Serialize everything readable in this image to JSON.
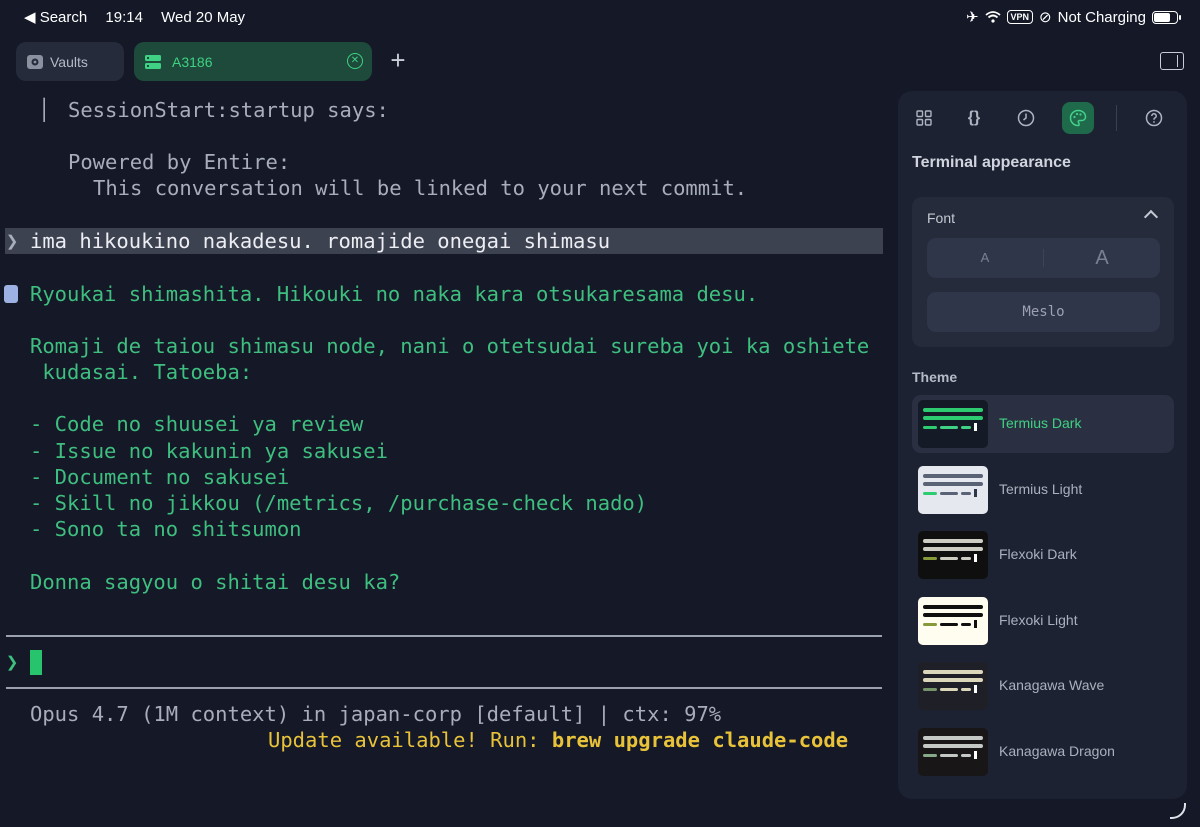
{
  "status_bar": {
    "back_label": "◀ Search",
    "time": "19:14",
    "date": "Wed 20 May",
    "vpn": "VPN",
    "charging": "Not Charging",
    "battery_level": 0.75
  },
  "tabs": [
    {
      "label": "Vaults",
      "icon": "vault-icon"
    },
    {
      "label": "A3186",
      "icon": "server-icon",
      "active": true
    }
  ],
  "terminal": {
    "hook_title": "SessionStart:startup says:",
    "hook_line1": "Powered by Entire:",
    "hook_line2": "This conversation will be linked to your next commit.",
    "user_prompt_glyph": "❯",
    "user_prompt": "ima hikoukino nakadesu. romajide onegai shimasu",
    "reply": [
      "Ryoukai shimashita. Hikouki no naka kara otsukaresama desu.",
      "Romaji de taiou shimasu node, nani o otetsudai sureba yoi ka oshiete",
      " kudasai. Tatoeba:",
      "- Code no shuusei ya review",
      "- Issue no kakunin ya sakusei",
      "- Document no sakusei",
      "- Skill no jikkou (/metrics, /purchase-check nado)",
      "- Sono ta no shitsumon",
      "Donna sagyou o shitai desu ka?"
    ],
    "input_prompt": "❯",
    "status_line": "Opus 4.7 (1M context) in japan-corp [default] | ctx: 97%",
    "update_prefix": "Update available! Run: ",
    "update_command": "brew upgrade claude-code"
  },
  "panel": {
    "title": "Terminal appearance",
    "font_section": "Font",
    "size_small": "A",
    "size_large": "A",
    "font_family": "Meslo",
    "theme_section": "Theme",
    "themes": [
      {
        "name": "Termius Dark",
        "selected": true,
        "bg": "#141a26",
        "bar1": "#2ecc71",
        "bar2": "#2ecc71",
        "d1": "#2ecc71",
        "d2": "#3fd184",
        "d3": "#3fd184",
        "d4": "#ffffff"
      },
      {
        "name": "Termius Light",
        "selected": false,
        "bg": "#e5e8ef",
        "bar1": "#5a6275",
        "bar2": "#5a6275",
        "d1": "#2ecc71",
        "d2": "#5a6275",
        "d3": "#5a6275",
        "d4": "#30364a"
      },
      {
        "name": "Flexoki Dark",
        "selected": false,
        "bg": "#100f0f",
        "bar1": "#cecdc3",
        "bar2": "#cecdc3",
        "d1": "#879a39",
        "d2": "#cecdc3",
        "d3": "#cecdc3",
        "d4": "#ffffff"
      },
      {
        "name": "Flexoki Light",
        "selected": false,
        "bg": "#fffcf0",
        "bar1": "#100f0f",
        "bar2": "#100f0f",
        "d1": "#879a39",
        "d2": "#100f0f",
        "d3": "#100f0f",
        "d4": "#100f0f"
      },
      {
        "name": "Kanagawa Wave",
        "selected": false,
        "bg": "#1f1f28",
        "bar1": "#dcd7ba",
        "bar2": "#dcd7ba",
        "d1": "#76946a",
        "d2": "#dcd7ba",
        "d3": "#dcd7ba",
        "d4": "#ffffff"
      },
      {
        "name": "Kanagawa Dragon",
        "selected": false,
        "bg": "#181616",
        "bar1": "#c5c9c5",
        "bar2": "#c5c9c5",
        "d1": "#87a987",
        "d2": "#c5c9c5",
        "d3": "#c5c9c5",
        "d4": "#ffffff"
      }
    ]
  }
}
